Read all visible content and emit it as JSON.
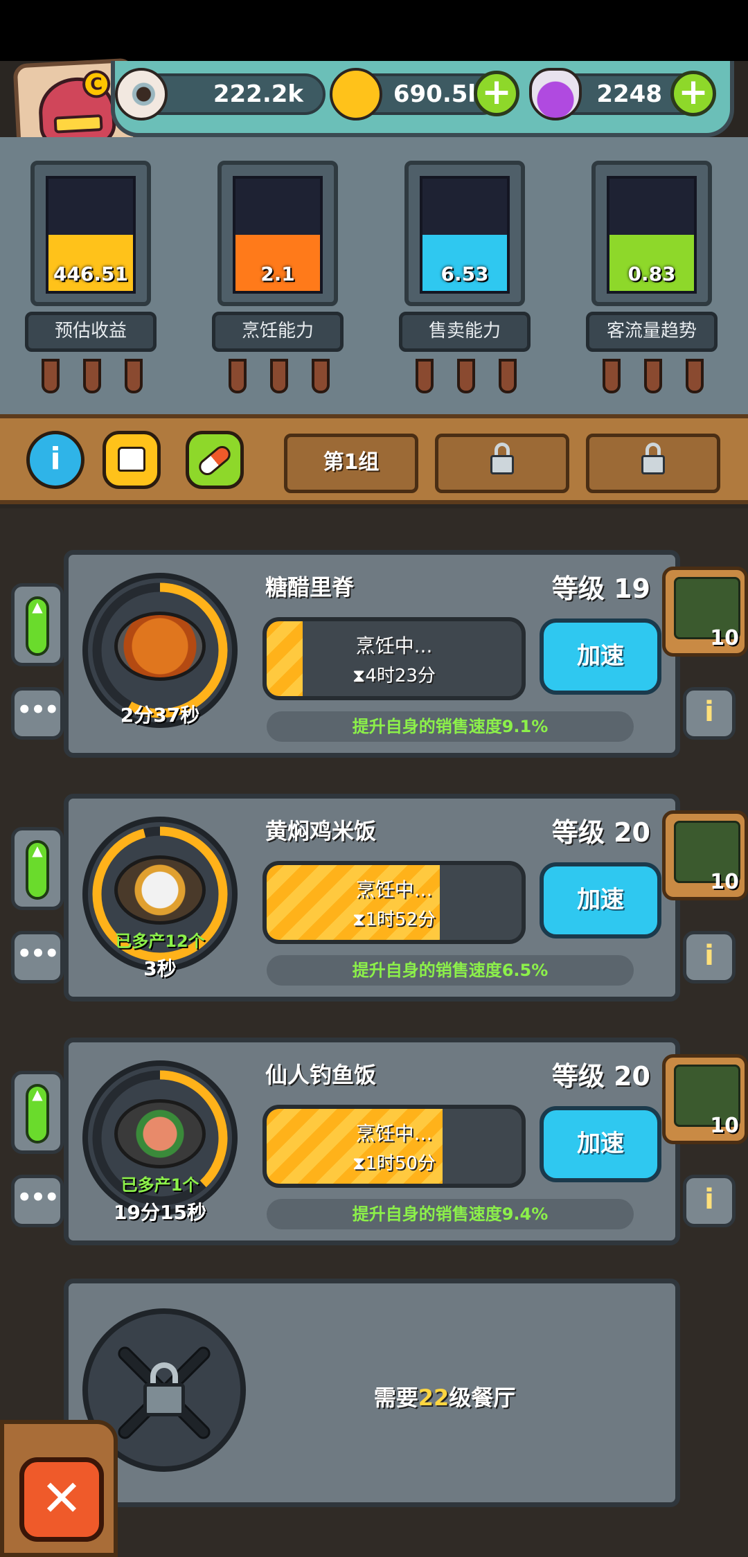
{
  "resources": {
    "eyes": "222.2k",
    "coins": "690.5k",
    "potions": "2248",
    "plus": "+"
  },
  "stats": [
    {
      "value": "446.51",
      "label": "预估收益",
      "fill_color": "#ffc21a",
      "level": 0.5
    },
    {
      "value": "2.1",
      "label": "烹饪能力",
      "fill_color": "#ff7a1a",
      "level": 0.5
    },
    {
      "value": "6.53",
      "label": "售卖能力",
      "fill_color": "#2fc8f0",
      "level": 0.5
    },
    {
      "value": "0.83",
      "label": "客流量趋势",
      "fill_color": "#8ed82a",
      "level": 0.5
    }
  ],
  "toolbar": {
    "info": "i",
    "group1": "第1组"
  },
  "dishes": [
    {
      "name": "糖醋里脊",
      "level": "等级 19",
      "status": "烹饪中...",
      "timer": "4时23分",
      "progress": 0.14,
      "speed_label": "加速",
      "bonus": "提升自身的销售速度9.1%",
      "extra": "",
      "countdown": "2分37秒",
      "chef_count": "10",
      "more": "•••",
      "info": "i"
    },
    {
      "name": "黄焖鸡米饭",
      "level": "等级 20",
      "status": "烹饪中...",
      "timer": "1时52分",
      "progress": 0.68,
      "speed_label": "加速",
      "bonus": "提升自身的销售速度6.5%",
      "extra": "已多产12个",
      "countdown": "3秒",
      "chef_count": "10",
      "more": "•••",
      "info": "i"
    },
    {
      "name": "仙人钓鱼饭",
      "level": "等级 20",
      "status": "烹饪中...",
      "timer": "1时50分",
      "progress": 0.69,
      "speed_label": "加速",
      "bonus": "提升自身的销售速度9.4%",
      "extra": "已多产1个",
      "countdown": "19分15秒",
      "chef_count": "10",
      "more": "•••",
      "info": "i"
    }
  ],
  "locked_slot": {
    "prefix": "需要",
    "level": "22",
    "suffix": "级餐厅"
  },
  "close": "✕"
}
